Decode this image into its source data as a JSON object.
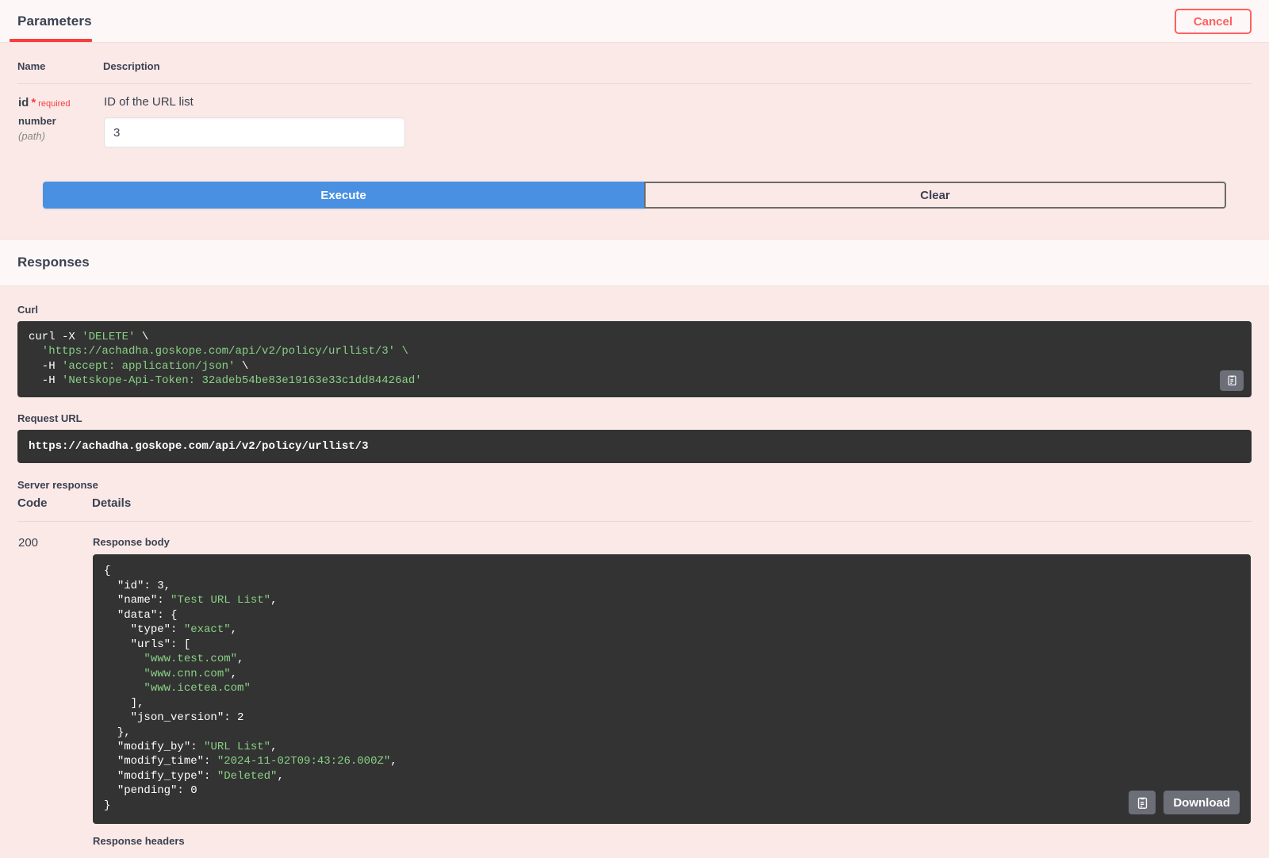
{
  "parameters": {
    "section_title": "Parameters",
    "cancel_label": "Cancel",
    "col_name": "Name",
    "col_description": "Description",
    "rows": [
      {
        "name": "id",
        "required_star": "*",
        "required_label": "required",
        "type": "number",
        "in": "(path)",
        "description": "ID of the URL list",
        "value": "3"
      }
    ]
  },
  "actions": {
    "execute_label": "Execute",
    "clear_label": "Clear"
  },
  "responses": {
    "section_title": "Responses",
    "curl_label": "Curl",
    "curl": {
      "line1_cmd": "curl -X ",
      "line1_method": "'DELETE'",
      "line1_cont": " \\",
      "line2": "  'https://achadha.goskope.com/api/v2/policy/urllist/3' \\",
      "line3_flag": "  -H ",
      "line3_val": "'accept: application/json'",
      "line3_cont": " \\",
      "line4_flag": "  -H ",
      "line4_val": "'Netskope-Api-Token: 32adeb54be83e19163e33c1dd84426ad'"
    },
    "request_url_label": "Request URL",
    "request_url": "https://achadha.goskope.com/api/v2/policy/urllist/3",
    "server_response_label": "Server response",
    "col_code": "Code",
    "col_details": "Details",
    "code": "200",
    "response_body_label": "Response body",
    "response_body": "{\n  \"id\": 3,\n  \"name\": \"Test URL List\",\n  \"data\": {\n    \"type\": \"exact\",\n    \"urls\": [\n      \"www.test.com\",\n      \"www.cnn.com\",\n      \"www.icetea.com\"\n    ],\n    \"json_version\": 2\n  },\n  \"modify_by\": \"URL List\",\n  \"modify_time\": \"2024-11-02T09:43:26.000Z\",\n  \"modify_type\": \"Deleted\",\n  \"pending\": 0\n}",
    "download_label": "Download",
    "response_headers_label": "Response headers"
  },
  "colors": {
    "accent_red": "#f93e3e",
    "execute_blue": "#4990e2",
    "page_bg": "#fbe9e7",
    "code_bg": "#333333",
    "string_green": "#89d185",
    "number_red": "#e06c75"
  }
}
